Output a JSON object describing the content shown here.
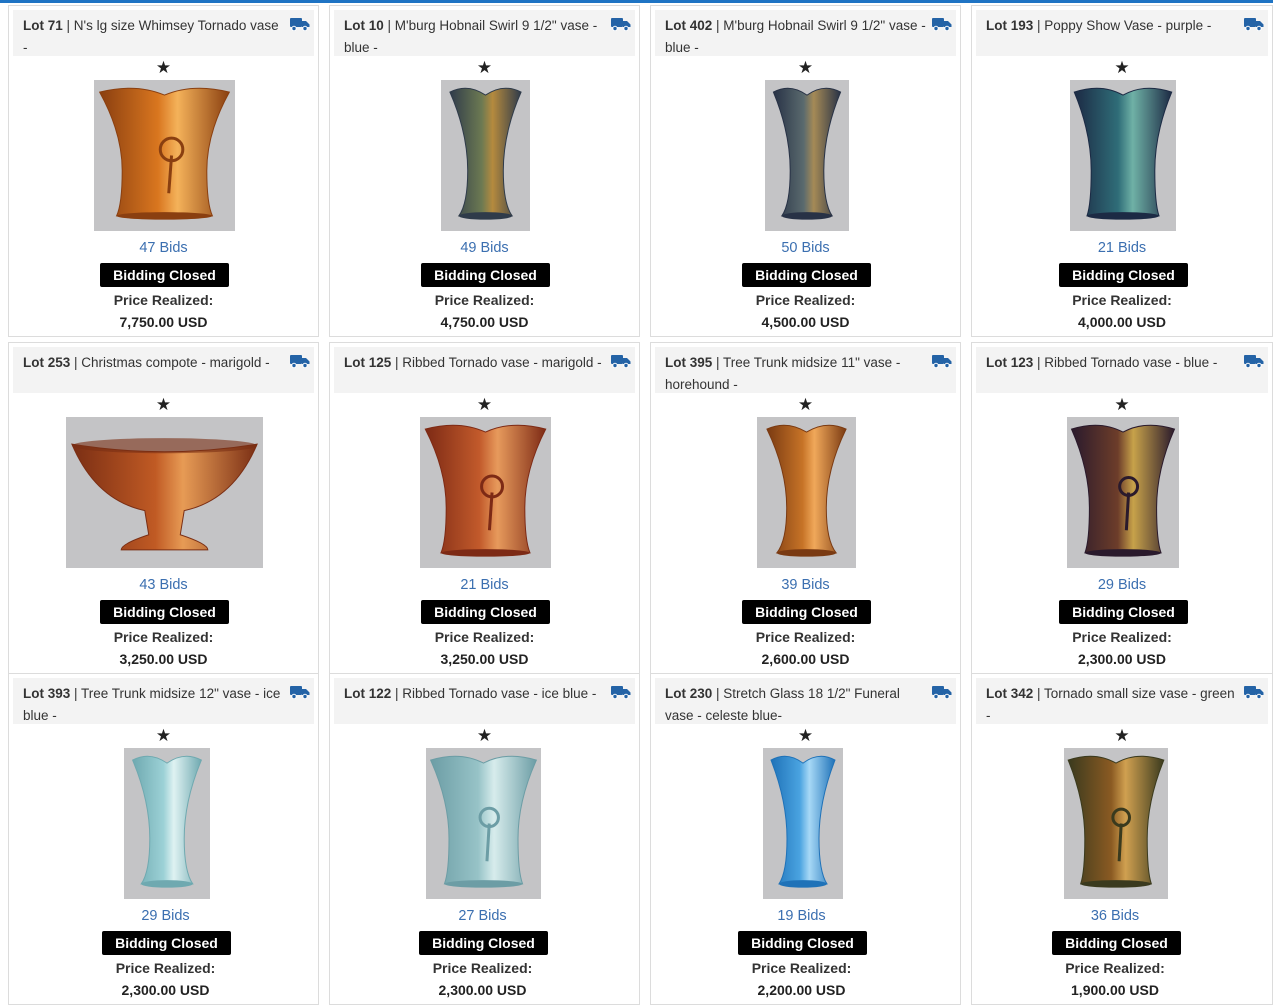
{
  "labels": {
    "bidding_closed": "Bidding Closed",
    "price_realized": "Price Realized:"
  },
  "colors": {
    "accent": "#1f74c4",
    "bids_link": "#3b6fb0",
    "badge": "#000000"
  },
  "lots": [
    {
      "lot": "Lot 71",
      "title": "N's lg size Whimsey Tornado vase",
      "sep": " -",
      "bids": "47 Bids",
      "price": "7,750.00 USD",
      "vase": "marigold-whimsey"
    },
    {
      "lot": "Lot 10",
      "title": "M'burg Hobnail Swirl 9 1/2\" vase - blue -",
      "sep": "",
      "bids": "49 Bids",
      "price": "4,750.00 USD",
      "vase": "hobnail-blue"
    },
    {
      "lot": "Lot 402",
      "title": "M'burg Hobnail Swirl 9 1/2\" vase - blue -",
      "sep": "",
      "bids": "50 Bids",
      "price": "4,500.00 USD",
      "vase": "hobnail-blue-2"
    },
    {
      "lot": "Lot 193",
      "title": "Poppy Show Vase - purple -",
      "sep": "",
      "bids": "21 Bids",
      "price": "4,000.00 USD",
      "vase": "poppy-purple"
    },
    {
      "lot": "Lot 253",
      "title": "Christmas compote - marigold -",
      "sep": "",
      "bids": "43 Bids",
      "price": "3,250.00 USD",
      "vase": "compote-marigold"
    },
    {
      "lot": "Lot 125",
      "title": "Ribbed Tornado vase - marigold -",
      "sep": "",
      "bids": "21 Bids",
      "price": "3,250.00 USD",
      "vase": "tornado-marigold"
    },
    {
      "lot": "Lot 395",
      "title": "Tree Trunk midsize 11\" vase - horehound -",
      "sep": "",
      "bids": "39 Bids",
      "price": "2,600.00 USD",
      "vase": "tree-trunk-horehound"
    },
    {
      "lot": "Lot 123",
      "title": "Ribbed Tornado vase - blue -",
      "sep": "",
      "bids": "29 Bids",
      "price": "2,300.00 USD",
      "vase": "tornado-blue"
    },
    {
      "lot": "Lot 393",
      "title": "Tree Trunk midsize 12\" vase - ice blue -",
      "sep": "",
      "bids": "29 Bids",
      "price": "2,300.00 USD",
      "vase": "tree-trunk-ice-blue"
    },
    {
      "lot": "Lot 122",
      "title": "Ribbed Tornado vase - ice blue -",
      "sep": "",
      "bids": "27 Bids",
      "price": "2,300.00 USD",
      "vase": "tornado-ice-blue"
    },
    {
      "lot": "Lot 230",
      "title": "Stretch Glass 18 1/2\" Funeral vase - celeste blue-",
      "sep": "",
      "bids": "19 Bids",
      "price": "2,200.00 USD",
      "vase": "stretch-celeste"
    },
    {
      "lot": "Lot 342",
      "title": "Tornado small size vase - green -",
      "sep": "",
      "bids": "36 Bids",
      "price": "1,900.00 USD",
      "vase": "tornado-green"
    }
  ]
}
